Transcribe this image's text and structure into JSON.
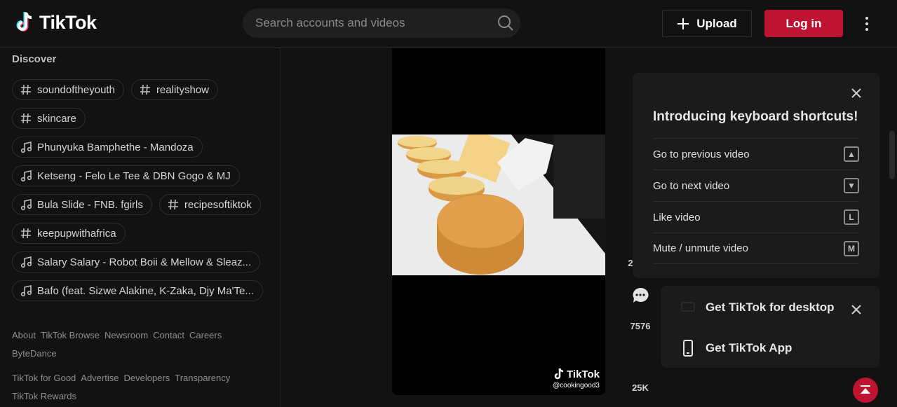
{
  "header": {
    "logo_text": "TikTok",
    "search_placeholder": "Search accounts and videos",
    "upload_label": "Upload",
    "login_label": "Log in"
  },
  "sidebar": {
    "discover_title": "Discover",
    "tags": [
      {
        "type": "hashtag",
        "label": "soundoftheyouth"
      },
      {
        "type": "hashtag",
        "label": "realityshow"
      },
      {
        "type": "hashtag",
        "label": "skincare"
      },
      {
        "type": "music",
        "label": "Phunyuka Bamphethe - Mandoza"
      },
      {
        "type": "music",
        "label": "Ketseng - Felo Le Tee & DBN Gogo & MJ"
      },
      {
        "type": "music",
        "label": "Bula Slide - FNB. fgirls"
      },
      {
        "type": "hashtag",
        "label": "recipesoftiktok"
      },
      {
        "type": "hashtag",
        "label": "keepupwithafrica"
      },
      {
        "type": "music",
        "label": "Salary Salary - Robot Boii & Mellow & Sleaz..."
      },
      {
        "type": "music",
        "label": "Bafo (feat. Sizwe Alakine, K-Zaka, Djy Ma'Te..."
      }
    ],
    "footer_row1": [
      "About",
      "TikTok Browse",
      "Newsroom",
      "Contact",
      "Careers",
      "ByteDance"
    ],
    "footer_row2": [
      "TikTok for Good",
      "Advertise",
      "Developers",
      "Transparency",
      "TikTok Rewards"
    ]
  },
  "video": {
    "watermark_brand": "TikTok",
    "watermark_handle": "@cookingood3"
  },
  "actions": {
    "like_count_partial": "2",
    "comment_count": "7576",
    "share_count": "25K"
  },
  "shortcuts_panel": {
    "title": "Introducing keyboard shortcuts!",
    "items": [
      {
        "label": "Go to previous video",
        "key": "▲"
      },
      {
        "label": "Go to next video",
        "key": "▼"
      },
      {
        "label": "Like video",
        "key": "L"
      },
      {
        "label": "Mute / unmute video",
        "key": "M"
      }
    ]
  },
  "get_panel": {
    "desktop_label": "Get TikTok for desktop",
    "app_label": "Get TikTok App"
  },
  "colors": {
    "accent": "#be1432",
    "background": "#121212"
  }
}
